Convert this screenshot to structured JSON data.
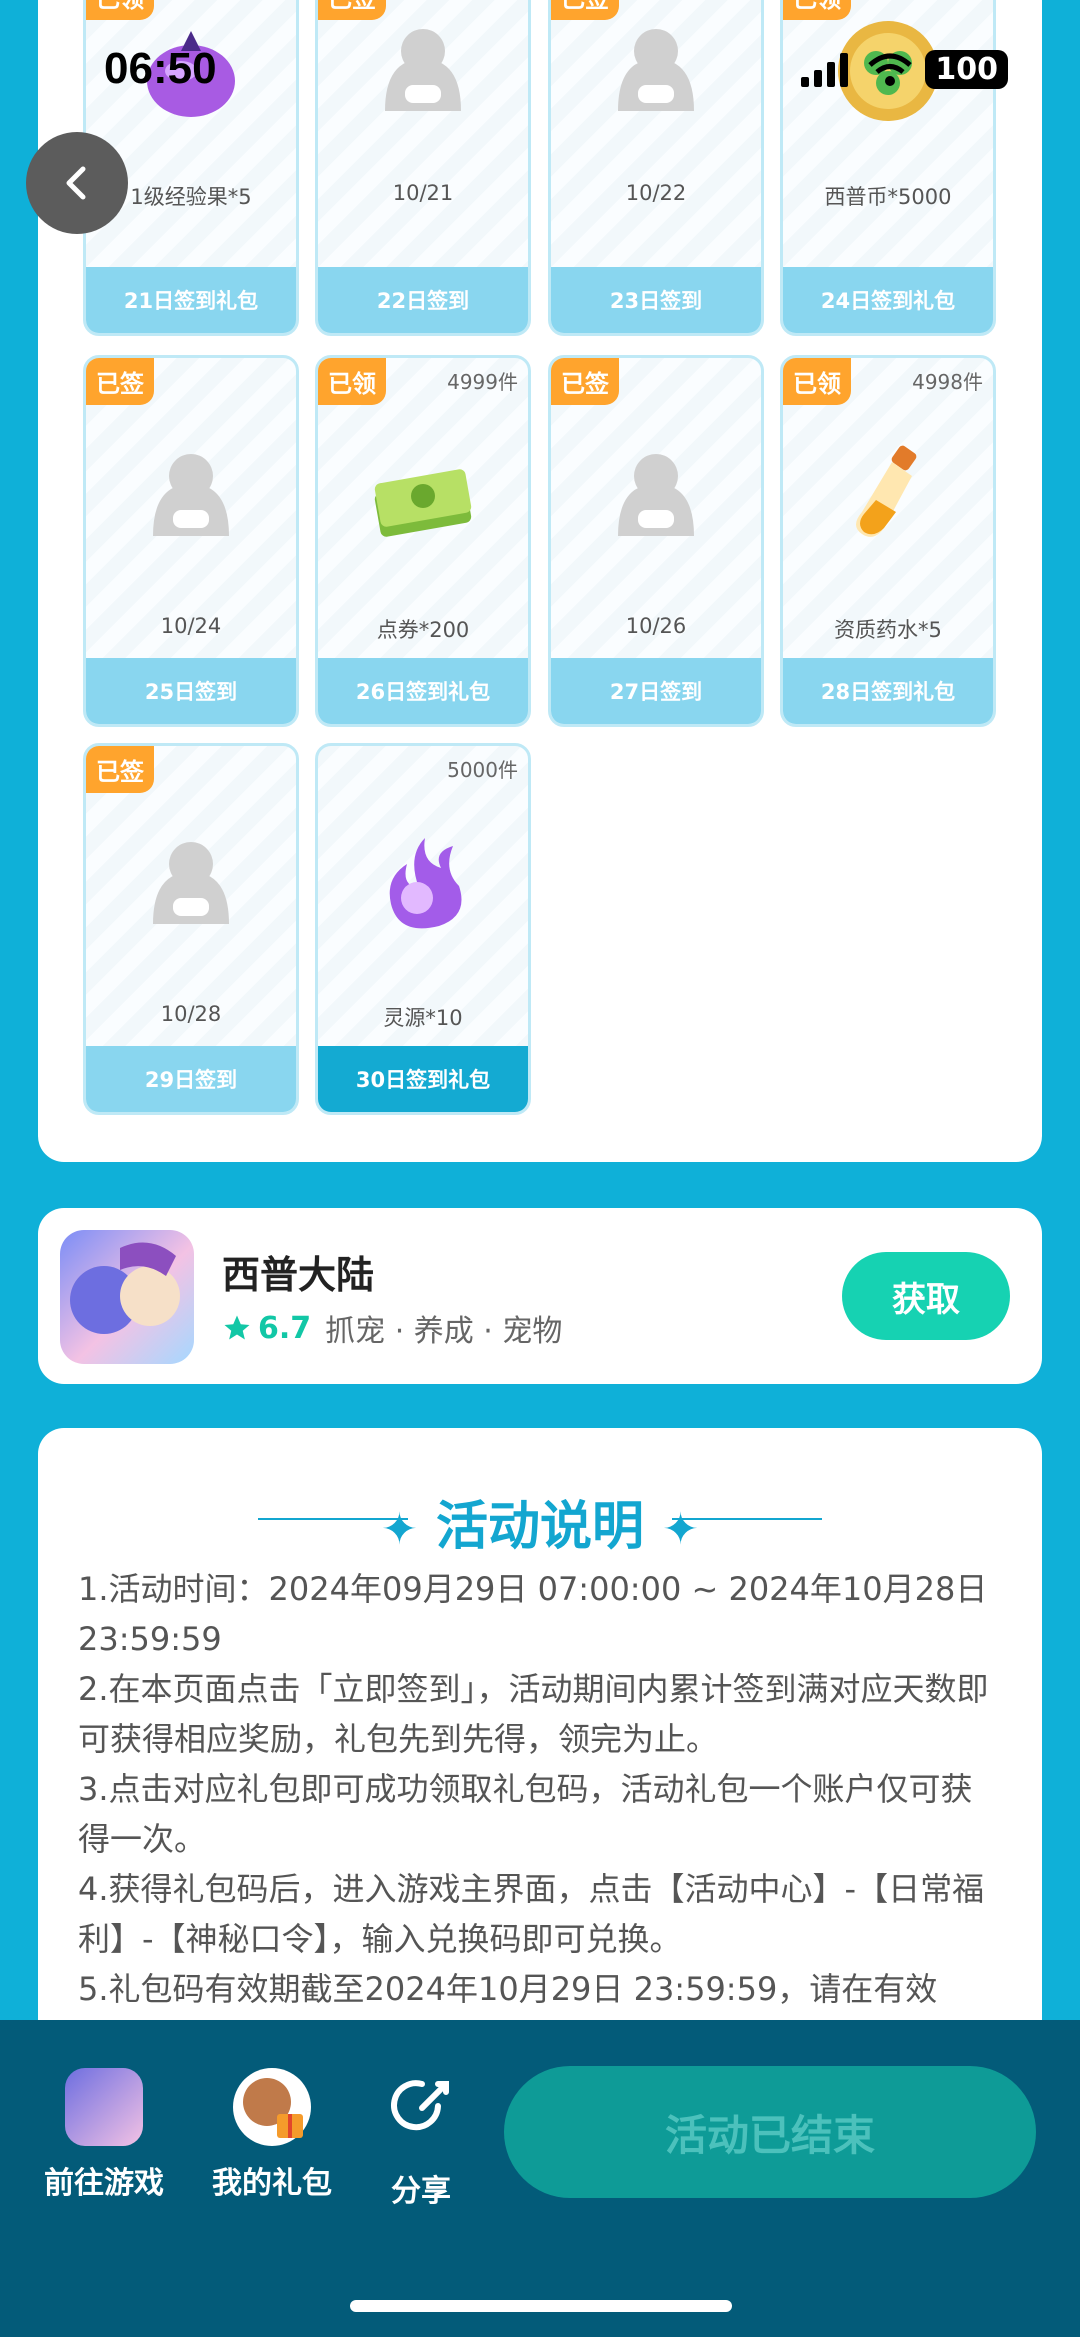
{
  "status_bar": {
    "time": "06:50",
    "battery": "100"
  },
  "grid": {
    "cells": [
      {
        "tag": "已领",
        "stock": "",
        "sub": "1级经验果*5",
        "label": "21日签到礼包",
        "icon": "purple-fruit-icon"
      },
      {
        "tag": "已签",
        "stock": "",
        "sub": "10/21",
        "label": "22日签到",
        "icon": "placeholder-avatar-icon"
      },
      {
        "tag": "已签",
        "stock": "",
        "sub": "10/22",
        "label": "23日签到",
        "icon": "placeholder-avatar-icon"
      },
      {
        "tag": "已领",
        "stock": "",
        "sub": "西普币*5000",
        "label": "24日签到礼包",
        "icon": "clover-coin-icon"
      },
      {
        "tag": "已签",
        "stock": "",
        "sub": "10/24",
        "label": "25日签到",
        "icon": "placeholder-avatar-icon"
      },
      {
        "tag": "已领",
        "stock": "4999件",
        "sub": "点券*200",
        "label": "26日签到礼包",
        "icon": "voucher-stack-icon"
      },
      {
        "tag": "已签",
        "stock": "",
        "sub": "10/26",
        "label": "27日签到",
        "icon": "placeholder-avatar-icon"
      },
      {
        "tag": "已领",
        "stock": "4998件",
        "sub": "资质药水*5",
        "label": "28日签到礼包",
        "icon": "potion-bottle-icon"
      },
      {
        "tag": "已签",
        "stock": "",
        "sub": "10/28",
        "label": "29日签到",
        "icon": "placeholder-avatar-icon"
      },
      {
        "tag": "",
        "stock": "5000件",
        "sub": "灵源*10",
        "label": "30日签到礼包",
        "icon": "spirit-flame-icon"
      }
    ]
  },
  "game": {
    "name": "西普大陆",
    "rating": "6.7",
    "tags": "抓宠 · 养成 · 宠物",
    "get_label": "获取"
  },
  "description": {
    "title": "活动说明",
    "lines": [
      "1.活动时间：2024年09月29日 07:00:00 ~ 2024年10月28日 23:59:59",
      "2.在本页面点击「立即签到」，活动期间内累计签到满对应天数即可获得相应奖励，礼包先到先得，领完为止。",
      "3.点击对应礼包即可成功领取礼包码，活动礼包一个账户仅可获得一次。",
      "4.获得礼包码后，进入游戏主界面，点击【活动中心】-【日常福利】-【神秘口令】，输入兑换码即可兑换。",
      "5.礼包码有效期截至2024年10月29日 23:59:59，请在有效"
    ]
  },
  "bottom_bar": {
    "goto_game": "前往游戏",
    "my_gifts": "我的礼包",
    "share": "分享",
    "ended": "活动已结束"
  }
}
